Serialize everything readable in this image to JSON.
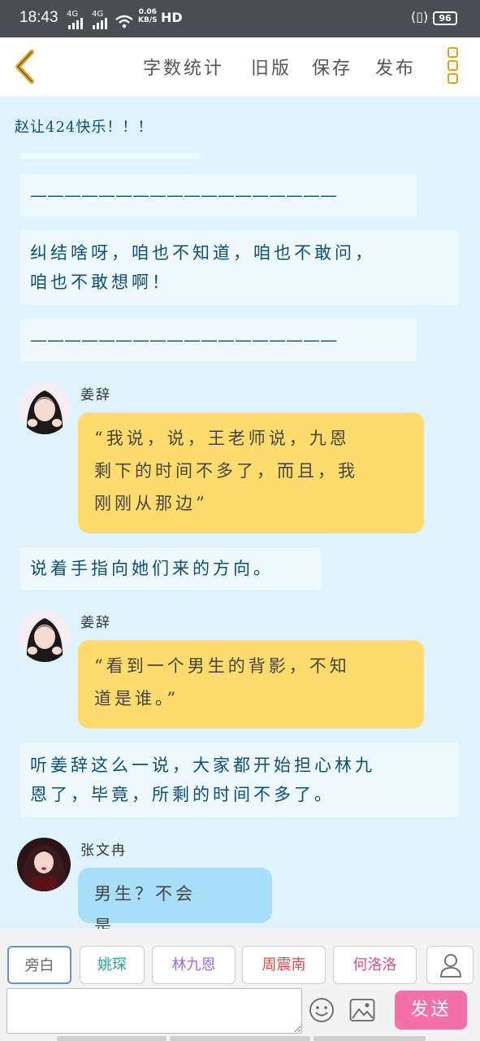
{
  "status_bar": {
    "time": "18:43",
    "signal_1": "4G",
    "signal_2": "4G",
    "net_speed_value": "0.06",
    "net_speed_unit": "KB/S",
    "hd": "HD",
    "battery": "96"
  },
  "header": {
    "menu": [
      {
        "label": "字数统计"
      },
      {
        "label": "旧版"
      },
      {
        "label": "保存"
      },
      {
        "label": "发布"
      }
    ],
    "accent": "#d7a720"
  },
  "story": {
    "title_line": "赵让424快乐！！！",
    "separator_1": "——————————————————",
    "narration_1_line_1": "纠结啥呀，咱也不知道，咱也不敢问，",
    "narration_1_line_2": "咱也不敢想啊！",
    "separator_2": "——————————————————",
    "dialog_1": {
      "speaker": "姜辞",
      "line_1": "“我说，说，王老师说，九恩",
      "line_2": "剩下的时间不多了，而且，我",
      "line_3": "刚刚从那边”"
    },
    "narration_2": "说着手指向她们来的方向。",
    "dialog_2": {
      "speaker": "姜辞",
      "line_1": "“看到一个男生的背影，不知",
      "line_2": "道是谁。”"
    },
    "narration_3_line_1": "听姜辞这么一说，大家都开始担心林九",
    "narration_3_line_2": "恩了，毕竟，所剩的时间不多了。",
    "dialog_3": {
      "speaker": "张文冉",
      "line_1": "男生？不会是……"
    }
  },
  "bottom": {
    "roles": [
      {
        "label": "旁白",
        "color": "#666666"
      },
      {
        "label": "姚琛",
        "color": "#2aa39a"
      },
      {
        "label": "林九恩",
        "color": "#9b6fd6"
      },
      {
        "label": "周震南",
        "color": "#e04a4a"
      },
      {
        "label": "何洛洛",
        "color": "#e0508c"
      }
    ],
    "input_value": "",
    "send_label": "发送",
    "send_color": "#f56fa8"
  }
}
